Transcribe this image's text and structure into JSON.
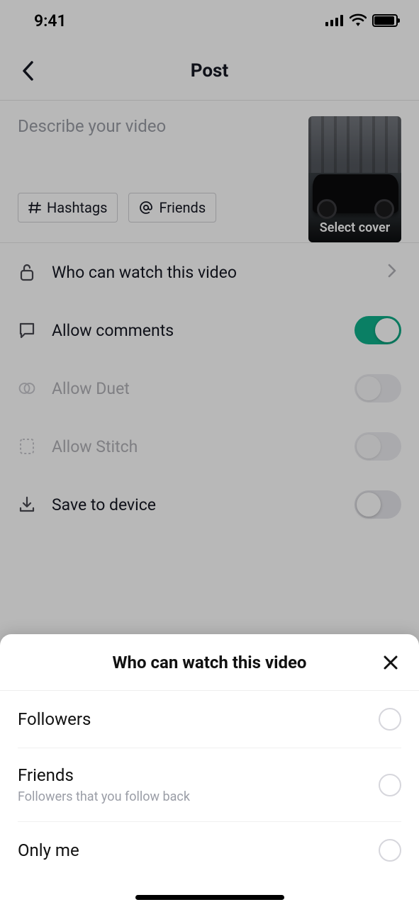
{
  "status_bar": {
    "time": "9:41"
  },
  "header": {
    "title": "Post"
  },
  "composer": {
    "placeholder": "Describe your video",
    "hashtags_label": "Hashtags",
    "friends_label": "Friends",
    "cover_label": "Select cover"
  },
  "settings": {
    "privacy_label": "Who can watch this video",
    "comments_label": "Allow comments",
    "duet_label": "Allow Duet",
    "stitch_label": "Allow Stitch",
    "save_label": "Save to device"
  },
  "sheet": {
    "title": "Who can watch this video",
    "options": [
      {
        "label": "Followers",
        "sub": ""
      },
      {
        "label": "Friends",
        "sub": "Followers that you follow back"
      },
      {
        "label": "Only me",
        "sub": ""
      }
    ]
  }
}
